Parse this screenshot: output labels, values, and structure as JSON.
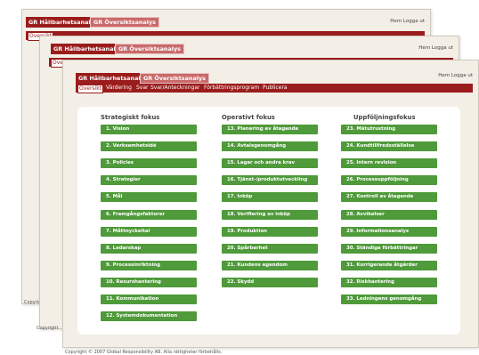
{
  "tabs": {
    "primary": "GR Hållbarhetsanalys",
    "secondary": "GR Översiktsanalys"
  },
  "header_links": "Hem Logga ut",
  "menu": [
    "Översikt",
    "Värdering",
    "Svar",
    "Svar/Anteckningar",
    "Förbättringsprogram",
    "Publicera"
  ],
  "columns": [
    {
      "title": "Strategiskt fokus",
      "items": [
        "1. Vision",
        "2. Verksamhetsidé",
        "3. Policies",
        "4. Strategier",
        "5. Mål",
        "6. Framgångsfaktorer",
        "7. Måttnyckeltal",
        "8. Ledarskap",
        "9. Processinriktning",
        "10. Resurshantering",
        "11. Kommunikation",
        "12. Systemdokumentation"
      ]
    },
    {
      "title": "Operativt fokus",
      "items": [
        "13. Planering av åtagande",
        "14. Avtalsgenomgång",
        "15. Lagar och andra krav",
        "16. Tjänst-/produktutveckling",
        "17. Inköp",
        "18. Verifiering av inköp",
        "19. Produktion",
        "20. Spårbarhet",
        "21. Kundens egendom",
        "22. Skydd"
      ]
    },
    {
      "title": "Uppföljningsfokus",
      "items": [
        "23. Mätutrustning",
        "24. Kundtillfredsställelse",
        "25. Intern revision",
        "26. Processuppföljning",
        "27. Kontroll av åtagande",
        "28. Avvikelser",
        "29. Informationsanalys",
        "30. Ständiga förbättringar",
        "31. Korrigerande åtgärder",
        "32. Riskhantering",
        "33. Ledningens genomgång"
      ]
    }
  ],
  "back_windows": {
    "copyright_short": "Copyright"
  },
  "footer": "Copyright © 2007 Global Responsibility AB. Alla rättigheter förbehålls.",
  "colors": {
    "brand_red": "#9b1c1c",
    "tab_light": "#c96a6a",
    "button_green": "#4f9a3a",
    "window_bg": "#f3efe7"
  }
}
